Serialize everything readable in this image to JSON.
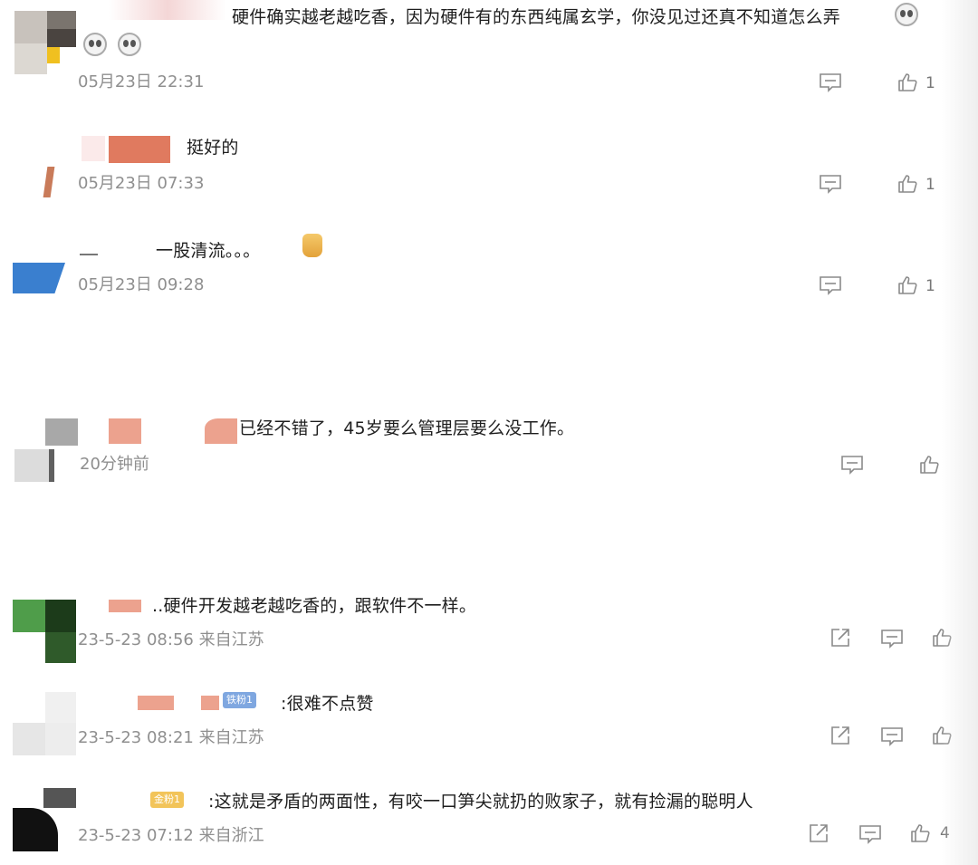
{
  "comments": [
    {
      "text": "硬件确实越老越吃香，因为硬件有的东西纯属玄学，你没见过还真不知道怎么弄",
      "meta": "05月23日 22:31",
      "likes": "1",
      "emojis": [
        "dizzy-face-emoji",
        "dizzy-face-emoji",
        "dizzy-face-emoji"
      ]
    },
    {
      "text": "挺好的",
      "meta": "05月23日 07:33",
      "likes": "1"
    },
    {
      "text": "一股清流。。。",
      "meta": "05月23日 09:28",
      "likes": "1",
      "emojis": [
        "thumbs-up-emoji"
      ]
    },
    {
      "text": "已经不错了，45岁要么管理层要么没工作。",
      "meta": "20分钟前",
      "likes": ""
    },
    {
      "text": "..硬件开发越老越吃香的，跟软件不一样。",
      "meta": "23-5-23 08:56 来自江苏",
      "likes": ""
    },
    {
      "text": ":很难不点赞",
      "meta": "23-5-23 08:21 来自江苏",
      "likes": "",
      "badge": "铁粉1"
    },
    {
      "text": ":这就是矛盾的两面性，有咬一口笋尖就扔的败家子，就有捡漏的聪明人",
      "meta": "23-5-23 07:12 来自浙江",
      "likes": "4",
      "badge": "金粉1"
    }
  ],
  "icons": {
    "reply": "comment-icon",
    "like": "thumbs-up-icon",
    "share": "share-icon"
  },
  "colors": {
    "text": "#1e1e1e",
    "meta": "#8f8f8f",
    "icon": "#8a8a8a",
    "blur_name": "#e07a5f",
    "badge_blue": "#7fa7e0",
    "badge_gold": "#f2c45a"
  }
}
